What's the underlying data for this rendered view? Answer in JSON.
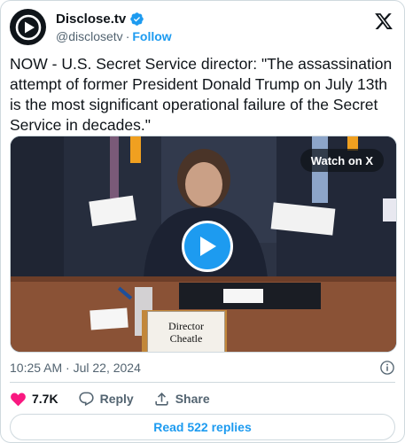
{
  "author": {
    "display_name": "Disclose.tv",
    "handle": "@disclosetv",
    "separator": "·",
    "follow_label": "Follow"
  },
  "tweet": {
    "text": "NOW - U.S. Secret Service director: \"The assassination attempt of former President Donald Trump on July 13th is the most significant operational failure of the Secret Service in decades.\""
  },
  "media": {
    "watch_label": "Watch on X",
    "nameplate_line1": "Director",
    "nameplate_line2": "Cheatle"
  },
  "meta": {
    "timestamp": "10:25 AM · Jul 22, 2024"
  },
  "actions": {
    "like_count": "7.7K",
    "reply_label": "Reply",
    "share_label": "Share"
  },
  "replies_button": "Read 522 replies",
  "colors": {
    "accent": "#1d9bf0",
    "like": "#f91880",
    "text": "#0f1419",
    "muted": "#536471"
  }
}
